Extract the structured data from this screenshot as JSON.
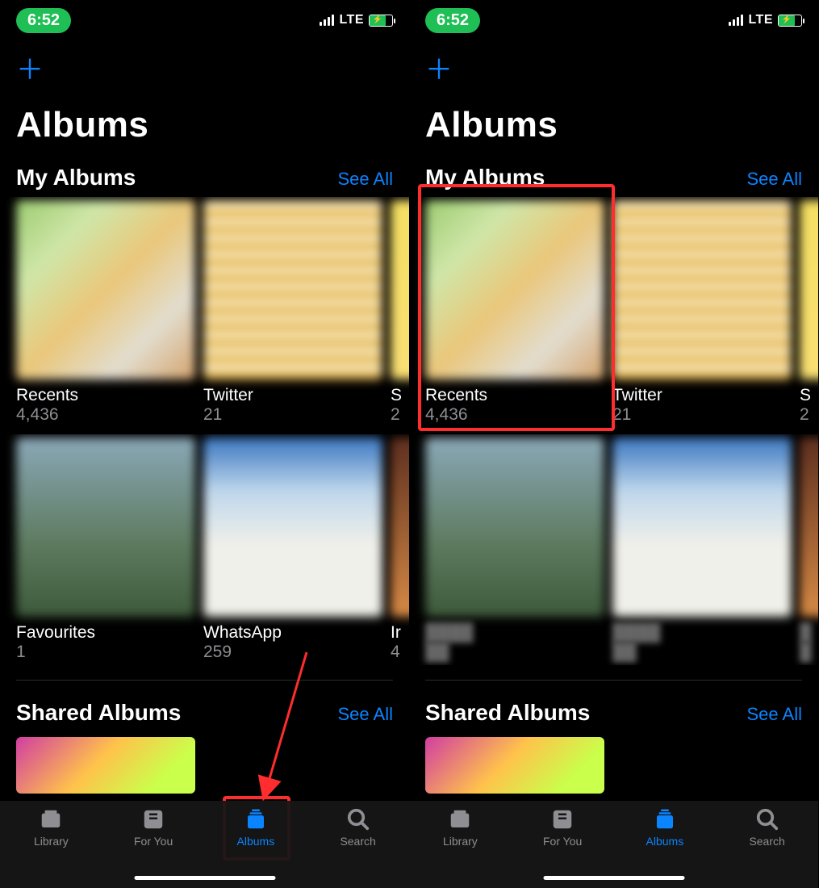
{
  "status": {
    "time": "6:52",
    "network": "LTE"
  },
  "header": {
    "title": "Albums"
  },
  "sections": {
    "my_albums": {
      "title": "My Albums",
      "see_all": "See All"
    },
    "shared_albums": {
      "title": "Shared Albums",
      "see_all": "See All"
    }
  },
  "left": {
    "albums_row1": [
      {
        "name": "Recents",
        "count": "4,436"
      },
      {
        "name": "Twitter",
        "count": "21"
      },
      {
        "name": "S",
        "count": "2"
      }
    ],
    "albums_row2": [
      {
        "name": "Favourites",
        "count": "1"
      },
      {
        "name": "WhatsApp",
        "count": "259"
      },
      {
        "name": "Ir",
        "count": "4"
      }
    ]
  },
  "right": {
    "albums_row1": [
      {
        "name": "Recents",
        "count": "4,436"
      },
      {
        "name": "Twitter",
        "count": "21"
      },
      {
        "name": "S",
        "count": "2"
      }
    ]
  },
  "tabs": {
    "library": "Library",
    "for_you": "For You",
    "albums": "Albums",
    "search": "Search"
  }
}
